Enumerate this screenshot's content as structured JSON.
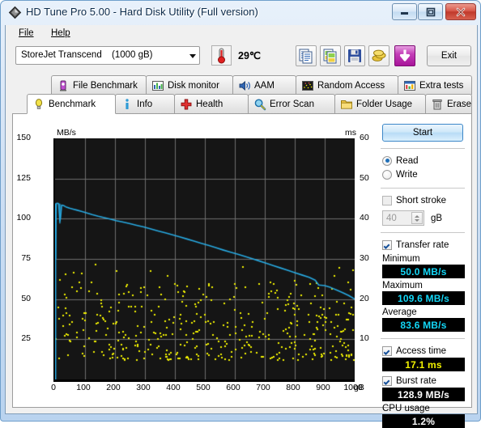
{
  "window": {
    "title": "HD Tune Pro 5.00 - Hard Disk Utility (Full version)",
    "icon": "hdtune-diamond-icon",
    "buttons": {
      "minimize": "minimize-button",
      "maximize": "maximize-button",
      "close": "✕"
    }
  },
  "menu": {
    "items": [
      {
        "label": "File",
        "accel": "F"
      },
      {
        "label": "Help",
        "accel": "H"
      }
    ]
  },
  "toolbar": {
    "drive": {
      "name": "StoreJet Transcend",
      "capacity": "(1000 gB)"
    },
    "temperature": "29℃",
    "temp_icon": "thermometer-icon",
    "buttons": [
      {
        "name": "copy-text-icon"
      },
      {
        "name": "copy-image-icon"
      },
      {
        "name": "save-icon"
      },
      {
        "name": "coins-icon"
      },
      {
        "name": "download-icon"
      }
    ],
    "exit_label": "Exit"
  },
  "tabs": {
    "top_row": [
      {
        "label": "File Benchmark",
        "icon": "file-benchmark-icon",
        "active": false
      },
      {
        "label": "Disk monitor",
        "icon": "disk-monitor-icon",
        "active": false
      },
      {
        "label": "AAM",
        "icon": "aam-speaker-icon",
        "active": false
      },
      {
        "label": "Random Access",
        "icon": "random-access-icon",
        "active": false
      },
      {
        "label": "Extra tests",
        "icon": "extra-tests-icon",
        "active": false
      }
    ],
    "bottom_row": [
      {
        "label": "Benchmark",
        "icon": "benchmark-bulb-icon",
        "active": true
      },
      {
        "label": "Info",
        "icon": "info-icon",
        "active": false
      },
      {
        "label": "Health",
        "icon": "health-cross-icon",
        "active": false
      },
      {
        "label": "Error Scan",
        "icon": "error-scan-magnifier-icon",
        "active": false
      },
      {
        "label": "Folder Usage",
        "icon": "folder-usage-icon",
        "active": false
      },
      {
        "label": "Erase",
        "icon": "erase-trash-icon",
        "active": false
      }
    ]
  },
  "controls": {
    "start_label": "Start",
    "mode": {
      "read": {
        "label": "Read",
        "selected": true
      },
      "write": {
        "label": "Write",
        "selected": false
      }
    },
    "short_stroke": {
      "label": "Short stroke",
      "checked": false
    },
    "short_stroke_value": "40",
    "short_stroke_unit": "gB",
    "transfer_rate": {
      "label": "Transfer rate",
      "checked": true
    },
    "access_time": {
      "label": "Access time",
      "checked": true
    },
    "burst_rate": {
      "label": "Burst rate",
      "checked": true
    },
    "cpu_usage_label": "CPU usage"
  },
  "results": {
    "minimum_label": "Minimum",
    "minimum_value": "50.0 MB/s",
    "maximum_label": "Maximum",
    "maximum_value": "109.6 MB/s",
    "average_label": "Average",
    "average_value": "83.6 MB/s",
    "access_time_value": "17.1 ms",
    "burst_rate_value": "128.9 MB/s",
    "cpu_usage_value": "1.2%"
  },
  "chart_data": {
    "type": "line",
    "title": "",
    "xlabel": "gB",
    "ylabel": "MB/s",
    "y2label": "ms",
    "xlim": [
      0,
      1000
    ],
    "ylim": [
      0,
      150
    ],
    "y2lim": [
      0,
      60
    ],
    "grid": true,
    "x_ticks": [
      0,
      100,
      200,
      300,
      400,
      500,
      600,
      700,
      800,
      900,
      1000
    ],
    "y_ticks": [
      25,
      50,
      75,
      100,
      125,
      150
    ],
    "y2_ticks": [
      10,
      20,
      30,
      40,
      50,
      60
    ],
    "x_unit_suffix": "gB",
    "background": "#151515",
    "grid_color": "#6e6e6e",
    "series": [
      {
        "name": "Transfer rate",
        "type": "line",
        "color": "#27a9e1",
        "axis": "left",
        "unit": "MB/s",
        "points": [
          [
            2,
            75
          ],
          [
            3,
            96
          ],
          [
            4,
            109.5
          ],
          [
            8,
            109.6
          ],
          [
            12,
            109.3
          ],
          [
            16,
            98.5
          ],
          [
            18,
            100.2
          ],
          [
            22,
            108.5
          ],
          [
            28,
            108.2
          ],
          [
            36,
            107.4
          ],
          [
            48,
            106.6
          ],
          [
            60,
            106.0
          ],
          [
            72,
            105.4
          ],
          [
            88,
            104.6
          ],
          [
            104,
            103.7
          ],
          [
            124,
            102.6
          ],
          [
            144,
            101.6
          ],
          [
            164,
            100.7
          ],
          [
            184,
            99.8
          ],
          [
            204,
            98.8
          ],
          [
            224,
            98.0
          ],
          [
            248,
            97.0
          ],
          [
            272,
            95.9
          ],
          [
            296,
            94.9
          ],
          [
            320,
            93.6
          ],
          [
            344,
            92.4
          ],
          [
            368,
            91.2
          ],
          [
            392,
            90.0
          ],
          [
            416,
            88.7
          ],
          [
            440,
            87.4
          ],
          [
            464,
            86.1
          ],
          [
            488,
            84.7
          ],
          [
            512,
            83.4
          ],
          [
            536,
            82.0
          ],
          [
            560,
            80.6
          ],
          [
            584,
            79.3
          ],
          [
            608,
            78.0
          ],
          [
            632,
            76.6
          ],
          [
            656,
            75.2
          ],
          [
            680,
            73.8
          ],
          [
            704,
            72.3
          ],
          [
            728,
            70.9
          ],
          [
            752,
            69.4
          ],
          [
            776,
            68.0
          ],
          [
            800,
            66.5
          ],
          [
            824,
            65.0
          ],
          [
            848,
            63.5
          ],
          [
            868,
            61.8
          ],
          [
            880,
            58.8
          ],
          [
            900,
            58.4
          ],
          [
            920,
            57.2
          ],
          [
            940,
            55.6
          ],
          [
            960,
            54.0
          ],
          [
            980,
            52.2
          ],
          [
            1000,
            50.0
          ]
        ]
      },
      {
        "name": "Access time",
        "type": "scatter",
        "color": "#f2f200",
        "axis": "right",
        "unit": "ms",
        "average": 17.1,
        "spread": [
          5,
          32
        ],
        "count": 430,
        "note": "Random access-time samples scattered across the full capacity, mostly between 5 and 25 ms."
      }
    ]
  }
}
